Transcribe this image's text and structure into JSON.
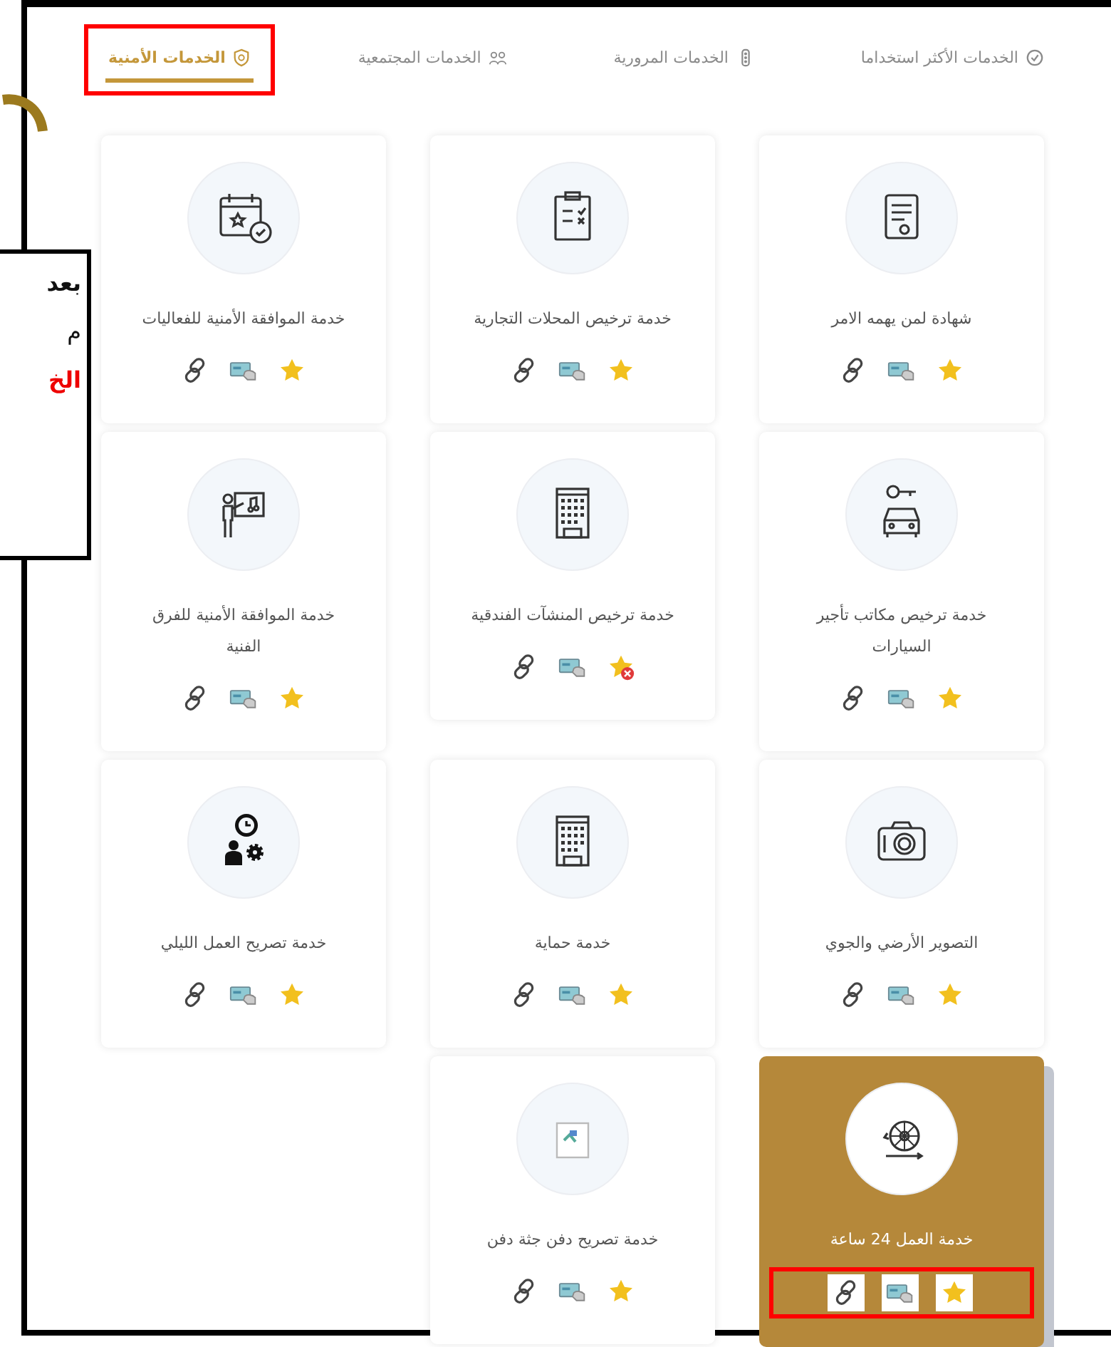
{
  "tabs": [
    {
      "label": "الخدمات الأكثر استخداما",
      "selected": false,
      "annotated": false
    },
    {
      "label": "الخدمات المرورية",
      "selected": false,
      "annotated": false
    },
    {
      "label": "الخدمات المجتمعية",
      "selected": false,
      "annotated": false
    },
    {
      "label": "الخدمات الأمنية",
      "selected": true,
      "annotated": true
    }
  ],
  "cards": [
    {
      "title": "شهادة لمن يهمه الامر",
      "favorite": true,
      "selected": false,
      "annotated": false
    },
    {
      "title": "خدمة ترخيص المحلات التجارية",
      "favorite": true,
      "selected": false,
      "annotated": false
    },
    {
      "title": "خدمة الموافقة الأمنية للفعاليات",
      "favorite": true,
      "selected": false,
      "annotated": false
    },
    {
      "title": "خدمة ترخيص مكاتب تأجير السيارات",
      "favorite": true,
      "selected": false,
      "annotated": false
    },
    {
      "title": "خدمة ترخيص المنشآت الفندقية",
      "favorite": false,
      "selected": false,
      "annotated": false
    },
    {
      "title": "خدمة الموافقة الأمنية للفرق الفنية",
      "favorite": true,
      "selected": false,
      "annotated": false
    },
    {
      "title": "التصوير الأرضي والجوي",
      "favorite": true,
      "selected": false,
      "annotated": false
    },
    {
      "title": "خدمة حماية",
      "favorite": true,
      "selected": false,
      "annotated": false
    },
    {
      "title": "خدمة تصريح العمل الليلي",
      "favorite": true,
      "selected": false,
      "annotated": false
    },
    {
      "title": "خدمة العمل 24 ساعة",
      "favorite": true,
      "selected": true,
      "annotated": true
    },
    {
      "title": "خدمة تصريح دفن جثة دفن",
      "favorite": true,
      "selected": false,
      "annotated": false
    }
  ],
  "callout": {
    "lines": [
      {
        "text": "بعد",
        "kind": "bold"
      },
      {
        "text": "م",
        "kind": "plain"
      },
      {
        "text": "الخ",
        "kind": "red"
      }
    ]
  }
}
